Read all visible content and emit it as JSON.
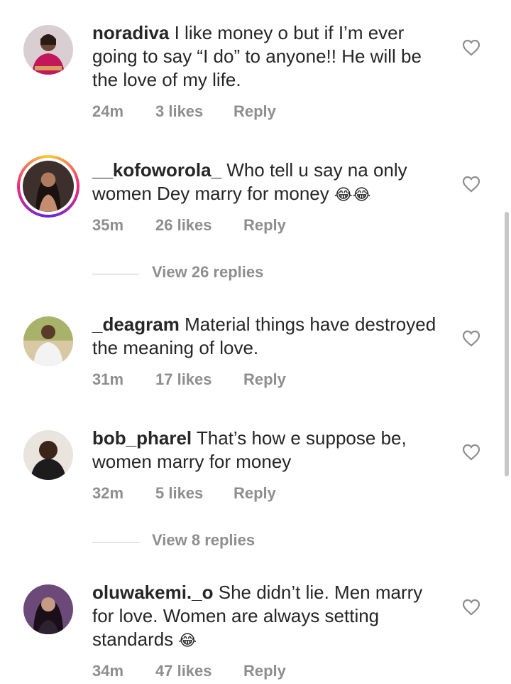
{
  "comments": [
    {
      "username": "noradiva",
      "text": " I like money o but if I’m ever going to say “I do” to anyone!! He will be the love of my life.",
      "time": "24m",
      "likes": "3 likes",
      "reply": "Reply"
    },
    {
      "username": "__kofoworola_",
      "text": " Who tell u say na only women Dey marry for money ",
      "emoji": "😂😂",
      "time": "35m",
      "likes": "26 likes",
      "reply": "Reply"
    },
    {
      "username": "_deagram",
      "text": " Material things have destroyed the meaning of love.",
      "time": "31m",
      "likes": "17 likes",
      "reply": "Reply"
    },
    {
      "username": "bob_pharel",
      "text": " That’s how e suppose be, women marry for money",
      "time": "32m",
      "likes": "5 likes",
      "reply": "Reply"
    },
    {
      "username": "oluwakemi._o",
      "text": " She didn’t lie. Men marry for love. Women are always setting standards ",
      "emoji": "😂",
      "time": "34m",
      "likes": "47 likes",
      "reply": "Reply"
    }
  ],
  "view_replies": [
    {
      "label": "View 26 replies"
    },
    {
      "label": "View 8 replies"
    }
  ],
  "icons": {
    "like": "heart-outline-icon"
  },
  "colors": {
    "text": "#262626",
    "muted": "#8e8e8e"
  }
}
